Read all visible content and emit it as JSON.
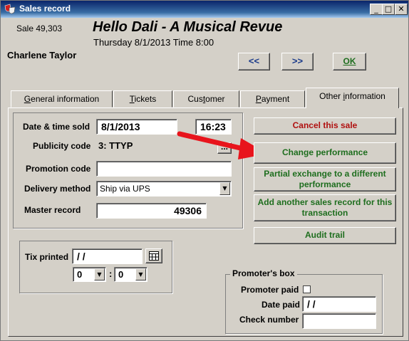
{
  "window": {
    "title": "Sales record",
    "minimize_glyph": "_",
    "maximize_glyph": "□",
    "close_glyph": "✕"
  },
  "header": {
    "sale_label": "Sale 49,303",
    "show_title": "Hello Dali - A Musical Revue",
    "performance": "Thursday 8/1/2013  Time 8:00",
    "customer_name": "Charlene Taylor"
  },
  "nav": {
    "prev_label": "<<",
    "next_label": ">>",
    "ok_label": "OK"
  },
  "tabs": [
    {
      "label": "General information",
      "active": false
    },
    {
      "label": "Tickets",
      "active": false
    },
    {
      "label": "Customer",
      "active": false
    },
    {
      "label": "Payment",
      "active": false
    },
    {
      "label": "Other information",
      "active": true
    }
  ],
  "form": {
    "date_time_sold_label": "Date & time sold",
    "date_sold": "8/1/2013",
    "time_sold": "16:23",
    "publicity_code_label": "Publicity code",
    "publicity_code_value": "3: TTYP",
    "ellipsis_label": "...",
    "promotion_code_label": "Promotion code",
    "promotion_code_value": "",
    "delivery_method_label": "Delivery method",
    "delivery_method_value": "Ship via UPS",
    "master_record_label": "Master record",
    "master_record_value": "49306"
  },
  "tix": {
    "label": "Tix printed",
    "date_value": " /  /",
    "hour_value": "0",
    "minute_value": "0",
    "separator": ":"
  },
  "actions": {
    "cancel_label": "Cancel this sale",
    "change_label": "Change performance",
    "partial_label": "Partial exchange to a different performance",
    "add_label": "Add another sales record for this transaction",
    "audit_label": "Audit trail"
  },
  "promoter": {
    "legend": "Promoter's box",
    "paid_label": "Promoter paid",
    "paid_checked": false,
    "date_paid_label": "Date paid",
    "date_paid_value": " /  /",
    "check_number_label": "Check number",
    "check_number_value": ""
  },
  "colors": {
    "action_text": "#1e6e1e",
    "cancel_text": "#b01010",
    "annotation_arrow": "#e8141c",
    "titlebar": "#0a246a"
  },
  "icons": {
    "app": "theater-masks-icon",
    "calendar": "calendar-icon",
    "dropdown": "chevron-down-icon"
  }
}
